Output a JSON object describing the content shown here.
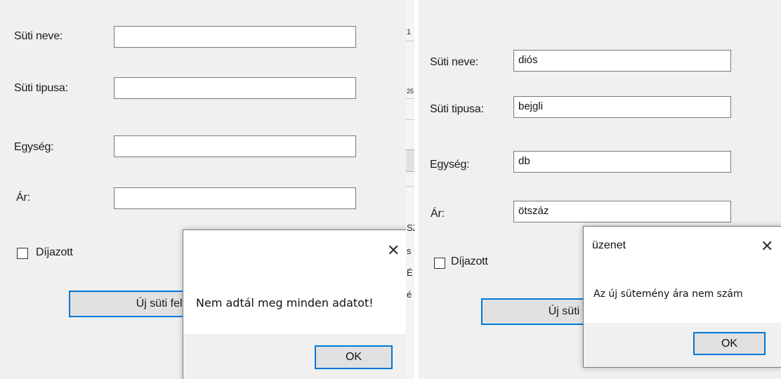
{
  "left_form": {
    "name_label": "Süti neve:",
    "name_value": "",
    "type_label": "Süti tipusa:",
    "type_value": "",
    "unit_label": "Egység:",
    "unit_value": "",
    "price_label": "Ár:",
    "price_value": "",
    "awarded_label": "Díjazott",
    "awarded_checked": false,
    "add_button": "Új süti felvétele"
  },
  "left_dialog": {
    "close_glyph": "✕",
    "message": "Nem adtál meg minden adatot!",
    "ok": "OK"
  },
  "background_window": {
    "fragments": [
      "1",
      "25",
      "SZ",
      "s",
      "É",
      "é"
    ]
  },
  "right_form": {
    "name_label": "Süti neve:",
    "name_value": "diós",
    "type_label": "Süti tipusa:",
    "type_value": "bejgli",
    "unit_label": "Egység:",
    "unit_value": "db",
    "price_label": "Ár:",
    "price_value": "ötszáz",
    "awarded_label": "Díjazott",
    "awarded_checked": false,
    "add_button": "Új süti felvétele"
  },
  "right_dialog": {
    "title": "üzenet",
    "close_glyph": "✕",
    "message": "Az új sütemény ára nem szám",
    "ok": "OK"
  },
  "colors": {
    "accent_border": "#0078d7",
    "form_background": "#f0f0f0",
    "button_face": "#e1e1e1"
  }
}
